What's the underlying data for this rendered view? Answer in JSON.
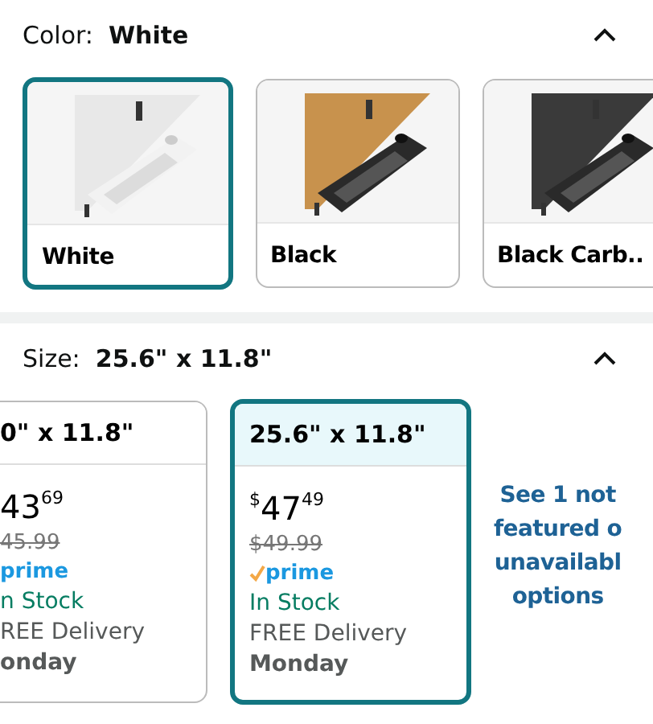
{
  "color_section": {
    "label": "Color:",
    "value": "White",
    "expanded": true,
    "options": [
      {
        "name": "White",
        "selected": true
      },
      {
        "name": "Black",
        "selected": false
      },
      {
        "name": "Black Carb..",
        "selected": false
      }
    ]
  },
  "size_section": {
    "label": "Size:",
    "value": "25.6\" x 11.8\"",
    "expanded": true,
    "options": [
      {
        "kind": "partial",
        "size": "0\" x 11.8\"",
        "selected": false,
        "whole": "43",
        "fraction": "69",
        "list_price": "45.99",
        "prime_check": false,
        "prime": "prime",
        "stock": "n Stock",
        "delivery": "REE Delivery",
        "day": "onday"
      },
      {
        "kind": "full",
        "size": "25.6\" x 11.8\"",
        "selected": true,
        "currency": "$",
        "whole": "47",
        "fraction": "49",
        "list_price": "$49.99",
        "prime_check": true,
        "prime": "prime",
        "stock": "In Stock",
        "delivery": "FREE Delivery",
        "day": "Monday"
      }
    ],
    "more_link": [
      "See 1 not",
      "featured o",
      "unavailabl",
      "options"
    ]
  }
}
